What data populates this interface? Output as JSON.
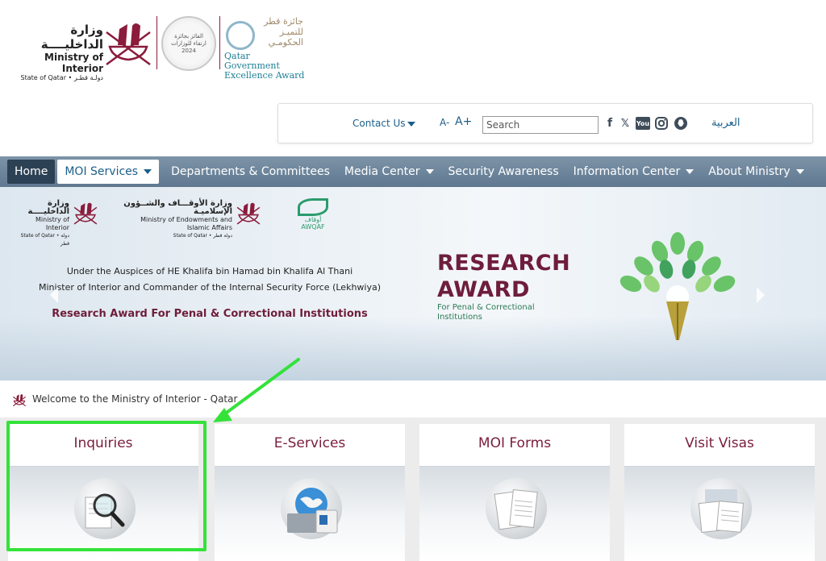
{
  "header": {
    "moi_name_ar": "وزارة الداخليــــة",
    "moi_name_en": "Ministry of Interior",
    "moi_state": "State of Qatar • دولـة قطـر",
    "seal_text_ar": "الفائز بجائزة",
    "seal_text_ar2": "ارتقاء للوزارات",
    "seal_year": "2024",
    "qga_name_ar": "جائزة قطر للتميـز الحكومـي",
    "qga_name_en_1": "Qatar Government",
    "qga_name_en_2": "Excellence Award"
  },
  "util_bar": {
    "contact_label": "Contact Us",
    "font_decrease": "A-",
    "font_increase": "A+",
    "search_placeholder": "Search",
    "social_facebook": "f",
    "social_x": "𝕏",
    "social_youtube": "You",
    "arabic_label": "العربية"
  },
  "nav": {
    "items": [
      {
        "label": "Home"
      },
      {
        "label": "MOI Services"
      },
      {
        "label": "Departments & Committees"
      },
      {
        "label": "Media Center"
      },
      {
        "label": "Security Awareness"
      },
      {
        "label": "Information Center"
      },
      {
        "label": "About Ministry"
      }
    ]
  },
  "banner": {
    "logo1_ar": "وزارة الداخليــــة",
    "logo1_en": "Ministry of Interior",
    "logo1_state": "State of Qatar • دولة قطر",
    "logo2_ar": "وزارة الأوقـــاف والشــؤون الإسلاميـة",
    "logo2_en": "Ministry of Endowments and Islamic Affairs",
    "logo2_state": "State of Qatar • دولة قطر",
    "logo3_ar": "أوقاف",
    "logo3_en": "AWQAF",
    "line1": "Under the Auspices of HE Khalifa bin Hamad bin Khalifa Al Thani",
    "line2": "Minister of Interior and Commander of the Internal Security Force (Lekhwiya)",
    "title": "Research Award For Penal & Correctional Institutions",
    "award_line1": "RESEARCH",
    "award_line2": "AWARD",
    "award_sub1": "For Penal & Correctional",
    "award_sub2": "Institutions"
  },
  "welcome": {
    "text": "Welcome to the Ministry of Interior - Qatar"
  },
  "cards": [
    {
      "title": "Inquiries"
    },
    {
      "title": "E-Services"
    },
    {
      "title": "MOI Forms"
    },
    {
      "title": "Visit Visas"
    }
  ],
  "colors": {
    "maroon": "#7a1d3e",
    "nav_bg": "#6b839a",
    "link_blue": "#1b5f8a",
    "highlight_green": "#34e23a"
  }
}
